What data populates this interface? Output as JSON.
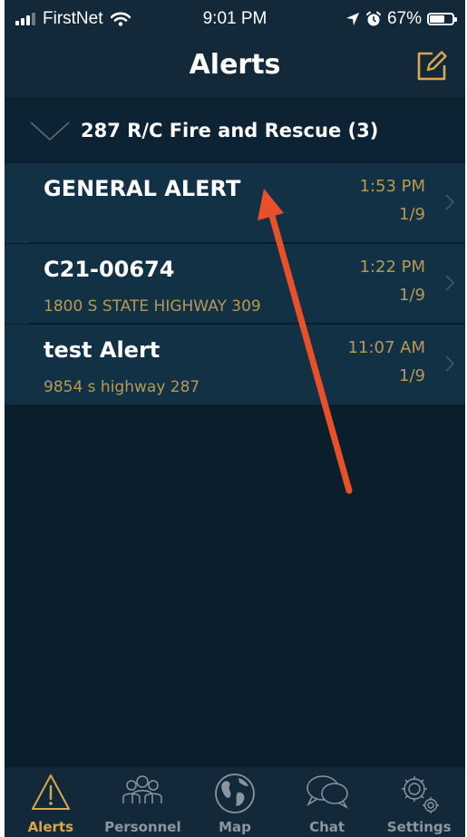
{
  "status_bar": {
    "carrier": "FirstNet",
    "time": "9:01 PM",
    "battery": "67%",
    "battery_level": 0.67
  },
  "header": {
    "title": "Alerts",
    "compose_icon": "compose-icon"
  },
  "group": {
    "title": "287 R/C Fire and Rescue (3)"
  },
  "alerts": [
    {
      "title": "GENERAL ALERT",
      "subtitle": "",
      "time": "1:53 PM",
      "count": "1/9"
    },
    {
      "title": "C21-00674",
      "subtitle": "1800 S STATE HIGHWAY 309",
      "time": "1:22 PM",
      "count": "1/9"
    },
    {
      "title": "test Alert",
      "subtitle": "9854 s highway 287",
      "time": "11:07 AM",
      "count": "1/9"
    }
  ],
  "tabs": [
    {
      "label": "Alerts",
      "icon": "warning-icon",
      "active": true
    },
    {
      "label": "Personnel",
      "icon": "people-icon",
      "active": false
    },
    {
      "label": "Map",
      "icon": "globe-icon",
      "active": false
    },
    {
      "label": "Chat",
      "icon": "chat-icon",
      "active": false
    },
    {
      "label": "Settings",
      "icon": "gears-icon",
      "active": false
    }
  ],
  "colors": {
    "background": "#0b1e2c",
    "bar": "#13293a",
    "item": "#133145",
    "accent_gold": "#d6a94e",
    "subtitle_gold": "#b59a57",
    "annotation_arrow": "#e8502a"
  }
}
